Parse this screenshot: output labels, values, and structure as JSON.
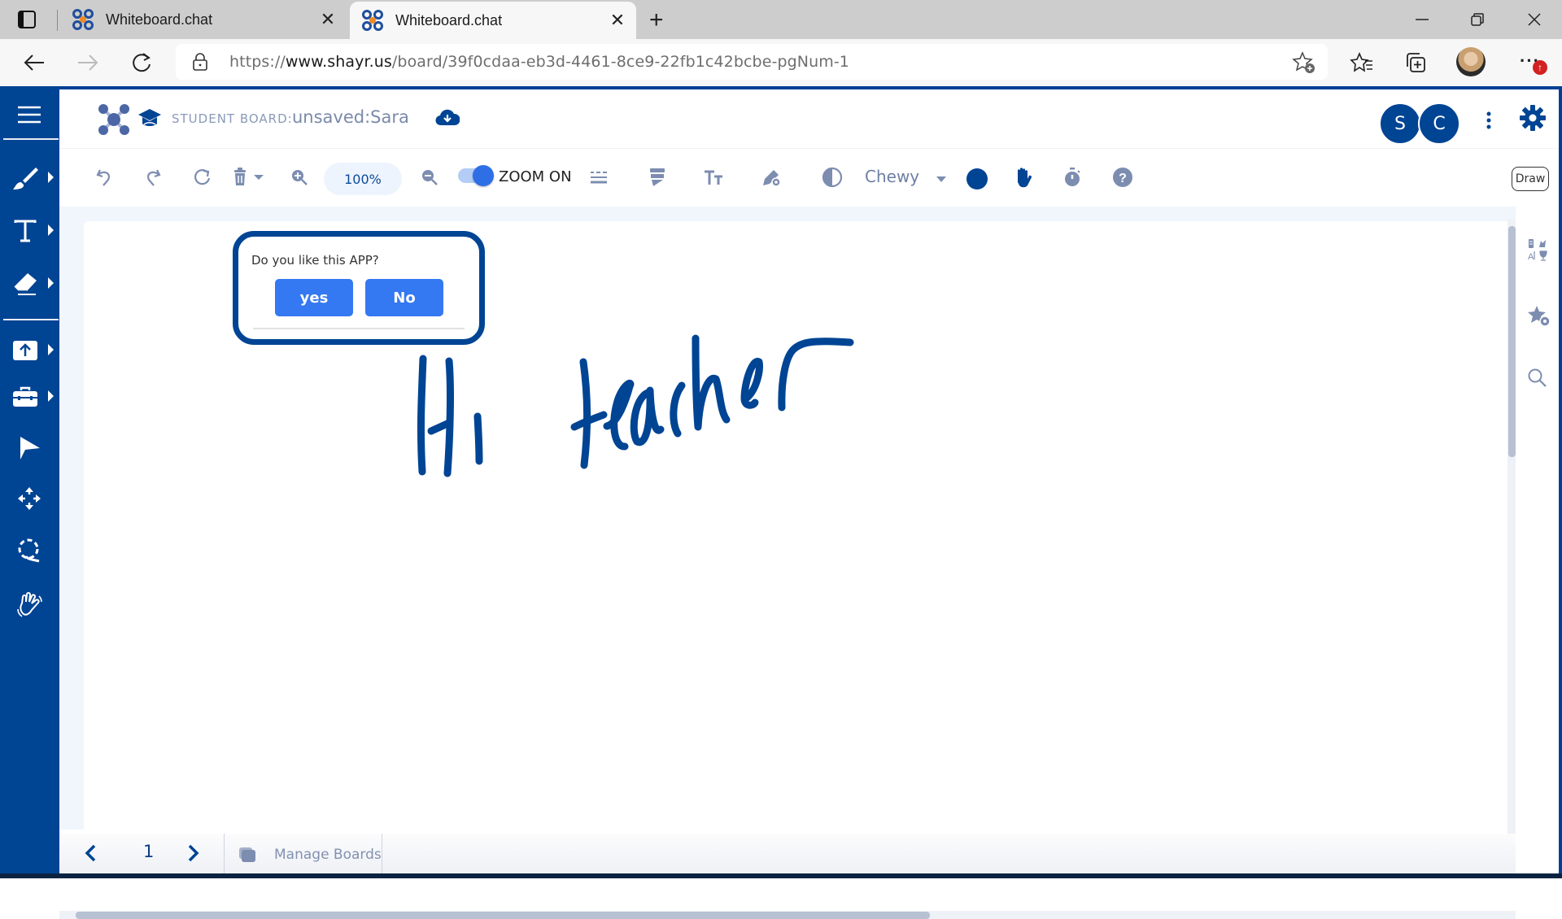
{
  "browser": {
    "tabs": [
      {
        "title": "Whiteboard.chat",
        "active": false
      },
      {
        "title": "Whiteboard.chat",
        "active": true
      }
    ],
    "url_scheme": "https://",
    "url_host": "www.shayr.us",
    "url_path": "/board/39f0cdaa-eb3d-4461-8ce9-22fb1c42bcbe-pgNum-1",
    "notification_badge": "↑"
  },
  "header": {
    "board_label": "STUDENT BOARD:",
    "board_name": "unsaved:Sara",
    "avatars": [
      "S",
      "C"
    ]
  },
  "toolbar": {
    "zoom_level": "100%",
    "zoom_toggle_label": "ZOOM ON",
    "zoom_toggle_on": true,
    "font_name": "Chewy",
    "pen_color": "#004494",
    "draw_button": "Draw"
  },
  "sidebar": {
    "items": [
      {
        "name": "menu"
      },
      {
        "name": "brush",
        "has_submenu": true
      },
      {
        "name": "text",
        "has_submenu": true
      },
      {
        "name": "eraser",
        "has_submenu": true
      },
      {
        "name": "upload",
        "has_submenu": true
      },
      {
        "name": "toolbox",
        "has_submenu": true
      },
      {
        "name": "select"
      },
      {
        "name": "move"
      },
      {
        "name": "lasso-zoom"
      },
      {
        "name": "raise-hand"
      }
    ]
  },
  "poll": {
    "question": "Do you like this APP?",
    "yes_label": "yes",
    "no_label": "No"
  },
  "canvas": {
    "handwriting_text": "Hi teacher",
    "ink_color": "#004494"
  },
  "footer": {
    "page_number": "1",
    "manage_boards_label": "Manage Boards"
  },
  "colors": {
    "brand": "#004494",
    "button_blue": "#3478f2",
    "icon_gray": "#7d8db0"
  }
}
